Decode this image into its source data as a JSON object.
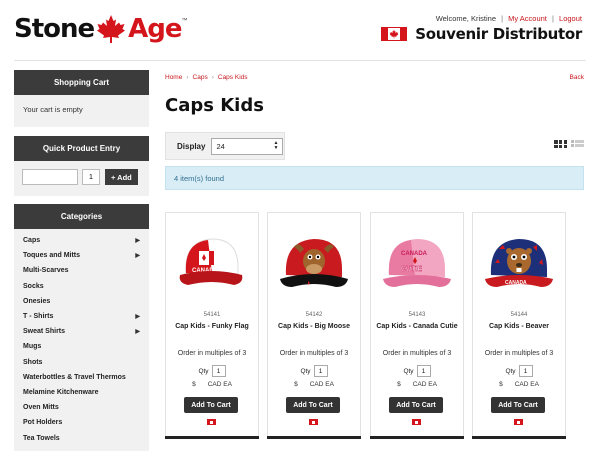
{
  "brand": {
    "logo_left": "Stone",
    "logo_right": "Age",
    "logo_tm": "™",
    "accent_color": "#d4161c"
  },
  "header": {
    "welcome_text": "Welcome, Kristine",
    "my_account": "My Account",
    "logout": "Logout",
    "distributor_title": "Souvenir Distributor"
  },
  "sidebar": {
    "cart_title": "Shopping Cart",
    "cart_empty": "Your cart is empty",
    "quick_entry_title": "Quick Product Entry",
    "quick_entry_qty": "1",
    "quick_entry_add": "+ Add",
    "categories_title": "Categories",
    "categories": [
      {
        "label": "Caps",
        "has_children": true
      },
      {
        "label": "Toques and Mitts",
        "has_children": true
      },
      {
        "label": "Multi-Scarves",
        "has_children": false
      },
      {
        "label": "Socks",
        "has_children": false
      },
      {
        "label": "Onesies",
        "has_children": false
      },
      {
        "label": "T - Shirts",
        "has_children": true
      },
      {
        "label": "Sweat Shirts",
        "has_children": true
      },
      {
        "label": "Mugs",
        "has_children": false
      },
      {
        "label": "Shots",
        "has_children": false
      },
      {
        "label": "Waterbottles & Travel Thermos",
        "has_children": false
      },
      {
        "label": "Melamine Kitchenware",
        "has_children": false
      },
      {
        "label": "Oven Mitts",
        "has_children": false
      },
      {
        "label": "Pot Holders",
        "has_children": false
      },
      {
        "label": "Tea Towels",
        "has_children": false
      }
    ]
  },
  "breadcrumb": {
    "home": "Home",
    "caps": "Caps",
    "current": "Caps Kids",
    "back": "Back"
  },
  "main": {
    "title": "Caps Kids",
    "display_label": "Display",
    "display_value": "24",
    "found_text": "4 item(s) found"
  },
  "products": [
    {
      "sku": "54141",
      "name": "Cap Kids - Funky Flag",
      "multiples": "Order in multiples of 3",
      "qty_label": "Qty",
      "qty": "1",
      "currency_symbol": "$",
      "currency_unit": "CAD EA",
      "add_label": "Add To Cart",
      "icon": "cap-funky-flag-icon",
      "color": "#d4161c"
    },
    {
      "sku": "54142",
      "name": "Cap Kids - Big Moose",
      "multiples": "Order in multiples of 3",
      "qty_label": "Qty",
      "qty": "1",
      "currency_symbol": "$",
      "currency_unit": "CAD EA",
      "add_label": "Add To Cart",
      "icon": "cap-big-moose-icon",
      "color": "#c81a1f"
    },
    {
      "sku": "54143",
      "name": "Cap Kids - Canada Cutie",
      "multiples": "Order in multiples of 3",
      "qty_label": "Qty",
      "qty": "1",
      "currency_symbol": "$",
      "currency_unit": "CAD EA",
      "add_label": "Add To Cart",
      "icon": "cap-canada-cutie-icon",
      "color": "#f08aae"
    },
    {
      "sku": "54144",
      "name": "Cap Kids - Beaver",
      "multiples": "Order in multiples of 3",
      "qty_label": "Qty",
      "qty": "1",
      "currency_symbol": "$",
      "currency_unit": "CAD EA",
      "add_label": "Add To Cart",
      "icon": "cap-beaver-icon",
      "color": "#1e2f7a"
    }
  ]
}
